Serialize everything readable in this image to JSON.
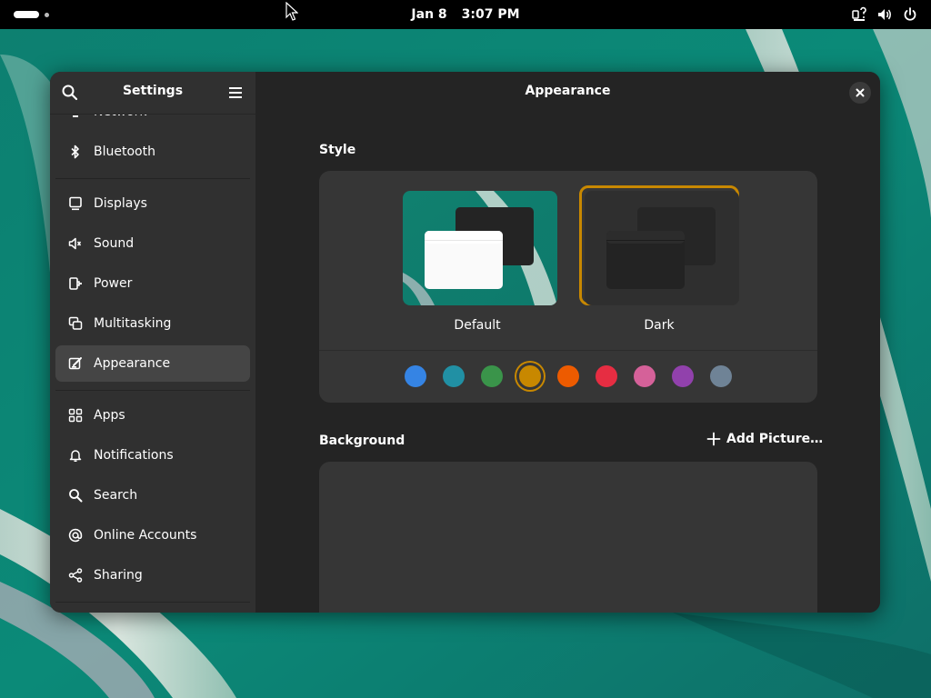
{
  "topbar": {
    "date": "Jan 8",
    "time": "3:07 PM",
    "tray_icons": [
      "accessibility-icon",
      "volume-icon",
      "power-icon"
    ]
  },
  "window": {
    "sidebar": {
      "title": "Settings",
      "items": [
        {
          "label": "Network",
          "icon": "network-icon"
        },
        {
          "label": "Bluetooth",
          "icon": "bluetooth-icon"
        },
        {
          "label": "Displays",
          "icon": "display-icon"
        },
        {
          "label": "Sound",
          "icon": "speaker-icon"
        },
        {
          "label": "Power",
          "icon": "power-plug-icon"
        },
        {
          "label": "Multitasking",
          "icon": "multitasking-icon"
        },
        {
          "label": "Appearance",
          "icon": "appearance-icon",
          "selected": true
        },
        {
          "label": "Apps",
          "icon": "apps-grid-icon"
        },
        {
          "label": "Notifications",
          "icon": "bell-icon"
        },
        {
          "label": "Search",
          "icon": "search-icon"
        },
        {
          "label": "Online Accounts",
          "icon": "at-sign-icon"
        },
        {
          "label": "Sharing",
          "icon": "share-icon"
        }
      ]
    },
    "content": {
      "title": "Appearance",
      "style_section": {
        "label": "Style",
        "options": [
          {
            "label": "Default",
            "selected": false
          },
          {
            "label": "Dark",
            "selected": true
          }
        ],
        "accent_colors": [
          "#3584e4",
          "#2190a4",
          "#3a944a",
          "#c88800",
          "#ed5b00",
          "#e62d42",
          "#d56199",
          "#9141ac",
          "#6f8396"
        ],
        "selected_accent": "#c88800"
      },
      "background_section": {
        "label": "Background",
        "add_picture_label": "Add Picture…"
      }
    }
  }
}
